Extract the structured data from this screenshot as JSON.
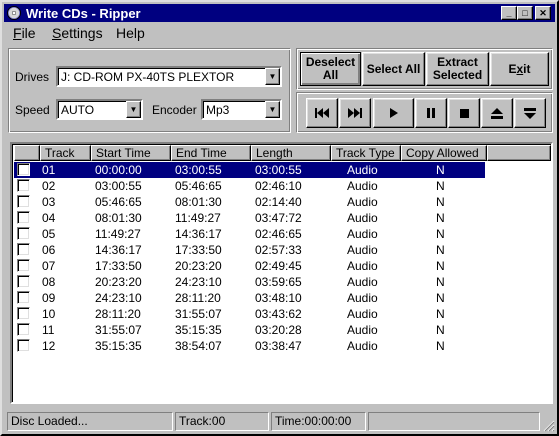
{
  "window": {
    "title": "Write CDs - Ripper",
    "controls": {
      "minimize": "_",
      "maximize": "□",
      "close": "✕"
    }
  },
  "menu": [
    {
      "label": "File",
      "mnemonic": "F",
      "rest": "ile"
    },
    {
      "label": "Settings",
      "mnemonic": "S",
      "rest": "ettings"
    },
    {
      "label": "Help",
      "mnemonic": "",
      "rest": "Help"
    }
  ],
  "settings": {
    "drives_label": "Drives",
    "drive_value": "J: CD-ROM PX-40TS   PLEXTOR",
    "speed_label": "Speed",
    "speed_value": "AUTO",
    "encoder_label": "Encoder",
    "encoder_value": "Mp3"
  },
  "actions": {
    "deselect_all_line1": "Deselect",
    "deselect_all_line2": "All",
    "select_all": "Select All",
    "extract_line1": "Extract",
    "extract_line2": "Selected",
    "exit": "Exit",
    "exit_mnemonic": "x"
  },
  "transport": {
    "icons": [
      "skip-back-icon",
      "skip-forward-icon",
      "play-icon",
      "pause-icon",
      "stop-icon",
      "eject-icon",
      "close-tray-icon"
    ]
  },
  "table": {
    "columns": [
      "Track",
      "Start Time",
      "End Time",
      "Length",
      "Track Type",
      "Copy Allowed"
    ],
    "selected_row": 0,
    "rows": [
      {
        "track": "01",
        "start": "00:00:00",
        "end": "03:00:55",
        "length": "03:00:55",
        "type": "Audio",
        "copy": "N"
      },
      {
        "track": "02",
        "start": "03:00:55",
        "end": "05:46:65",
        "length": "02:46:10",
        "type": "Audio",
        "copy": "N"
      },
      {
        "track": "03",
        "start": "05:46:65",
        "end": "08:01:30",
        "length": "02:14:40",
        "type": "Audio",
        "copy": "N"
      },
      {
        "track": "04",
        "start": "08:01:30",
        "end": "11:49:27",
        "length": "03:47:72",
        "type": "Audio",
        "copy": "N"
      },
      {
        "track": "05",
        "start": "11:49:27",
        "end": "14:36:17",
        "length": "02:46:65",
        "type": "Audio",
        "copy": "N"
      },
      {
        "track": "06",
        "start": "14:36:17",
        "end": "17:33:50",
        "length": "02:57:33",
        "type": "Audio",
        "copy": "N"
      },
      {
        "track": "07",
        "start": "17:33:50",
        "end": "20:23:20",
        "length": "02:49:45",
        "type": "Audio",
        "copy": "N"
      },
      {
        "track": "08",
        "start": "20:23:20",
        "end": "24:23:10",
        "length": "03:59:65",
        "type": "Audio",
        "copy": "N"
      },
      {
        "track": "09",
        "start": "24:23:10",
        "end": "28:11:20",
        "length": "03:48:10",
        "type": "Audio",
        "copy": "N"
      },
      {
        "track": "10",
        "start": "28:11:20",
        "end": "31:55:07",
        "length": "03:43:62",
        "type": "Audio",
        "copy": "N"
      },
      {
        "track": "11",
        "start": "31:55:07",
        "end": "35:15:35",
        "length": "03:20:28",
        "type": "Audio",
        "copy": "N"
      },
      {
        "track": "12",
        "start": "35:15:35",
        "end": "38:54:07",
        "length": "03:38:47",
        "type": "Audio",
        "copy": "N"
      }
    ]
  },
  "status": {
    "message": "Disc Loaded...",
    "track": "Track:00",
    "time": "Time:00:00:00"
  }
}
